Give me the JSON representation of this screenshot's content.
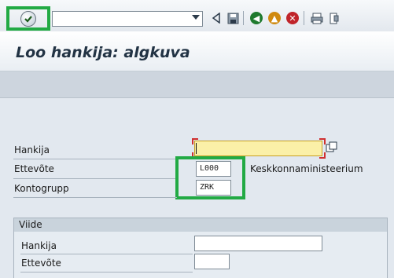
{
  "toolbar": {
    "ok_icon": "checkmark-icon",
    "command_field_value": "",
    "icons": [
      "back-triangle-icon",
      "save-icon",
      "back-circle-icon",
      "exit-circle-icon",
      "cancel-circle-icon",
      "print-icon",
      "find-icon"
    ]
  },
  "header": {
    "title": "Loo hankija: algkuva"
  },
  "form": {
    "vendor_label": "Hankija",
    "vendor_value": "",
    "company_label": "Ettevõte",
    "company_value": "L000",
    "company_desc": "Keskkonnaministeerium",
    "account_group_label": "Kontogrupp",
    "account_group_value": "ZRK"
  },
  "reference": {
    "title": "Viide",
    "vendor_label": "Hankija",
    "vendor_value": "",
    "company_label": "Ettevõte",
    "company_value": ""
  },
  "colors": {
    "highlight": "#22aa44",
    "required_field": "#fbf0a8",
    "title_text": "#223344"
  }
}
